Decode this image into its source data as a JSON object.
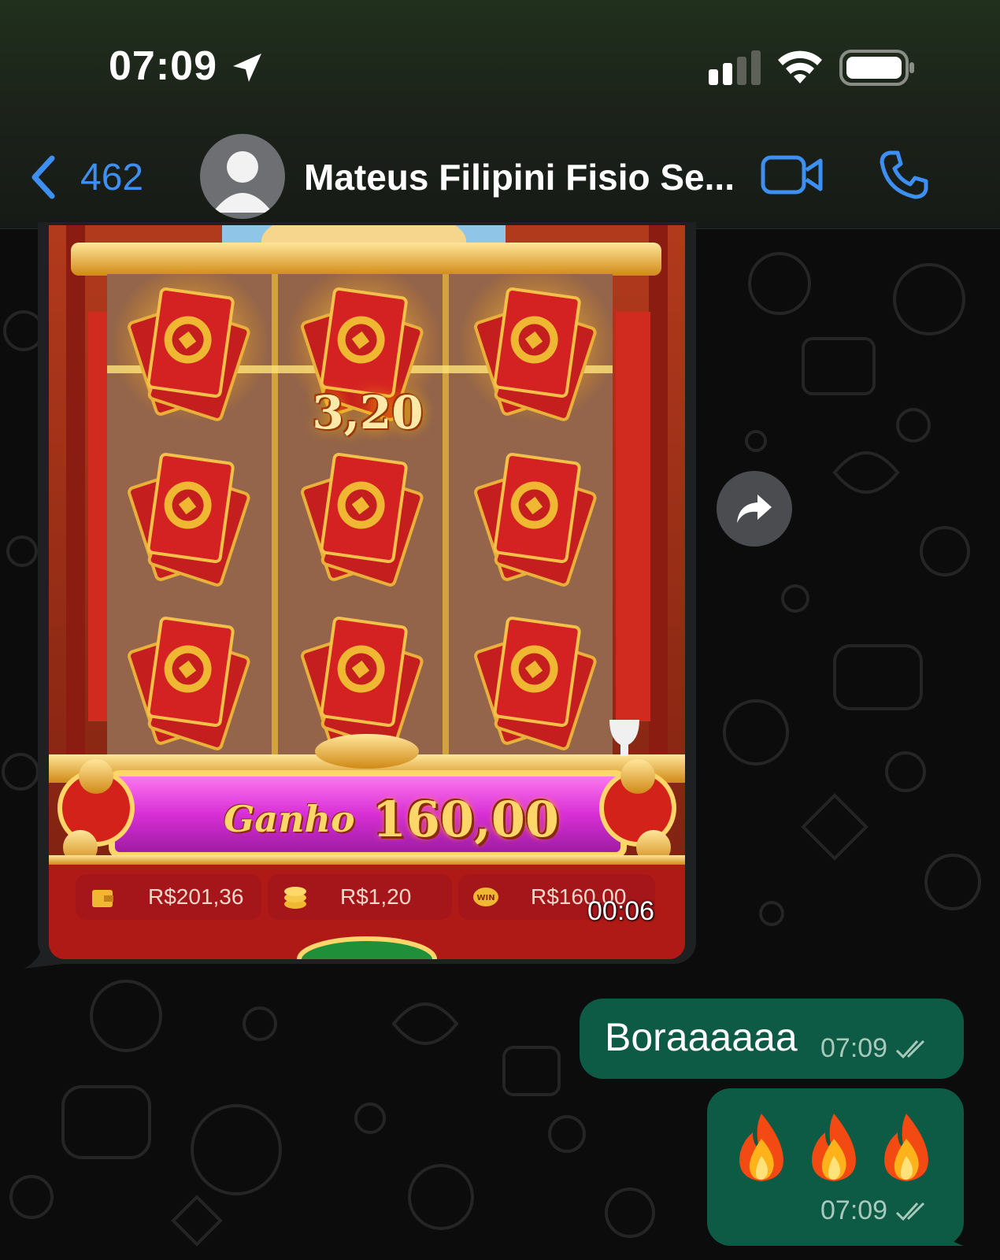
{
  "status_bar": {
    "time": "07:09"
  },
  "header": {
    "back_count": "462",
    "contact_name": "Mateus Filipini Fisio Se..."
  },
  "media_message": {
    "reel_value": "3,20",
    "win_label": "Ganho",
    "win_amount": "160,00",
    "stats": {
      "balance": "R$201,36",
      "bet": "R$1,20",
      "win": "R$160,00"
    },
    "win_badge": "WIN",
    "duration": "00:06"
  },
  "messages": [
    {
      "text": "Boraaaaaa",
      "time": "07:09"
    },
    {
      "emojis": [
        "fire-icon",
        "fire-icon",
        "fire-icon"
      ],
      "time": "07:09"
    }
  ],
  "colors": {
    "accent_blue": "#3d8ff2",
    "outgoing_bubble": "#0d5b44",
    "read_ticks": "#a9c9bd"
  }
}
